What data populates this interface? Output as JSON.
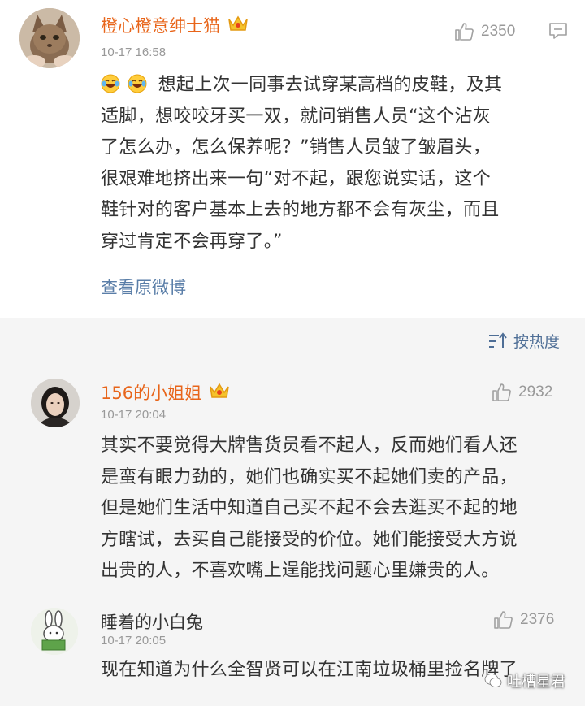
{
  "post": {
    "user_name": "橙心橙意绅士猫",
    "timestamp": "10-17 16:58",
    "like_count": "2350",
    "emoji_icons": [
      "laugh-cry-icon",
      "laugh-cry-icon"
    ],
    "content_lines": [
      "想起上次一同事去试穿某高档的皮鞋，及其",
      "适脚，想咬咬牙买一双，就问销售人员“这个沾灰",
      "了怎么办，怎么保养呢？”销售人员皱了皱眉头，",
      "很艰难地挤出来一句“对不起，跟您说实话，这个",
      "鞋针对的客户基本上去的地方都不会有灰尘，而且",
      "穿过肯定不会再穿了。”"
    ],
    "view_original_label": "查看原微博"
  },
  "sort": {
    "label": "按热度",
    "icon": "sort-icon"
  },
  "comments": [
    {
      "user_name": "156的小姐姐",
      "timestamp": "10-17 20:04",
      "like_count": "2932",
      "content_lines": [
        "其实不要觉得大牌售货员看不起人，反而她们看人还",
        "是蛮有眼力劲的，她们也确实买不起她们卖的产品，",
        "但是她们生活中知道自己买不起不会去逛买不起的地",
        "方瞎试，去买自己能接受的价位。她们能接受大方说",
        "出贵的人，不喜欢嘴上逞能找问题心里嫌贵的人。"
      ]
    },
    {
      "user_name": "睡着的小白兔",
      "timestamp": "10-17 20:05",
      "like_count": "2376",
      "content_lines": [
        "现在知道为什么全智贤可以在江南垃圾桶里捡名牌了"
      ]
    }
  ],
  "watermark": {
    "text": "吐槽星君"
  },
  "colors": {
    "username_vip": "#e8651a",
    "link": "#5a7ea8",
    "meta": "#999999",
    "background": "#f5f5f5"
  }
}
